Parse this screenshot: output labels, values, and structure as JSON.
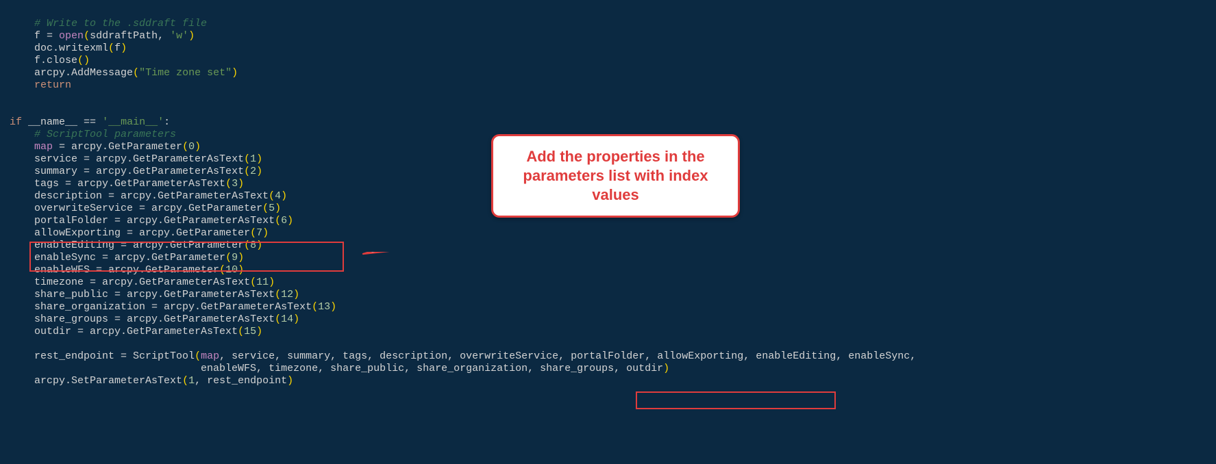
{
  "callout_text": "Add the properties in the parameters list with index values",
  "code": {
    "c01": "# Write to the .sddraft file",
    "l02a": "f ",
    "l02b": "= ",
    "l02c": "open",
    "l02d": "(",
    "l02e": "sddraftPath",
    "l02f": ", ",
    "l02g": "'w'",
    "l02h": ")",
    "l03a": "doc.writexml",
    "l03b": "(",
    "l03c": "f",
    "l03d": ")",
    "l04a": "f.close",
    "l04b": "()",
    "l05a": "arcpy.AddMessage",
    "l05b": "(",
    "l05c": "\"Time zone set\"",
    "l05d": ")",
    "l06a": "return",
    "l08a": "if",
    "l08b": " __name__ ",
    "l08c": "==",
    "l08d": " ",
    "l08e": "'__main__'",
    "l08f": ":",
    "c09": "# ScriptTool parameters",
    "l10a": "map",
    "l10b": " = arcpy.GetParameter",
    "l10c": "(",
    "l10d": "0",
    "l10e": ")",
    "l11a": "service = arcpy.GetParameterAsText",
    "l11b": "(",
    "l11c": "1",
    "l11d": ")",
    "l12a": "summary = arcpy.GetParameterAsText",
    "l12b": "(",
    "l12c": "2",
    "l12d": ")",
    "l13a": "tags = arcpy.GetParameterAsText",
    "l13b": "(",
    "l13c": "3",
    "l13d": ")",
    "l14a": "description = arcpy.GetParameterAsText",
    "l14b": "(",
    "l14c": "4",
    "l14d": ")",
    "l15a": "overwriteService = arcpy.GetParameter",
    "l15b": "(",
    "l15c": "5",
    "l15d": ")",
    "l16a": "portalFolder = arcpy.GetParameterAsText",
    "l16b": "(",
    "l16c": "6",
    "l16d": ")",
    "l17a": "allowExporting = arcpy.GetParameter",
    "l17b": "(",
    "l17c": "7",
    "l17d": ")",
    "l18a": "enableEditing = arcpy.GetParameter",
    "l18b": "(",
    "l18c": "8",
    "l18d": ")",
    "l19a": "enableSync = arcpy.GetParameter",
    "l19b": "(",
    "l19c": "9",
    "l19d": ")",
    "l20a": "enableWFS = arcpy.GetParameter",
    "l20b": "(",
    "l20c": "10",
    "l20d": ")",
    "l21a": "timezone = arcpy.GetParameterAsText",
    "l21b": "(",
    "l21c": "11",
    "l21d": ")",
    "l22a": "share_public = arcpy.GetParameterAsText",
    "l22b": "(",
    "l22c": "12",
    "l22d": ")",
    "l23a": "share_organization = arcpy.GetParameterAsText",
    "l23b": "(",
    "l23c": "13",
    "l23d": ")",
    "l24a": "share_groups = arcpy.GetParameterAsText",
    "l24b": "(",
    "l24c": "14",
    "l24d": ")",
    "l25a": "outdir = arcpy.GetParameterAsText",
    "l25b": "(",
    "l25c": "15",
    "l25d": ")",
    "l27a": "rest_endpoint = ScriptTool",
    "l27b": "(",
    "l27c": "map",
    "l27d": ", service, summary, tags, description, overwriteService, portalFolder, allowExporting, enableEditing, enableSync,",
    "l28a": "enableWFS, timezone, share_public, share_organization, share_groups, outdir",
    "l28b": ")",
    "l29a": "arcpy.SetParameterAsText",
    "l29b": "(",
    "l29c": "1",
    "l29d": ", rest_endpoint",
    "l29e": ")"
  }
}
